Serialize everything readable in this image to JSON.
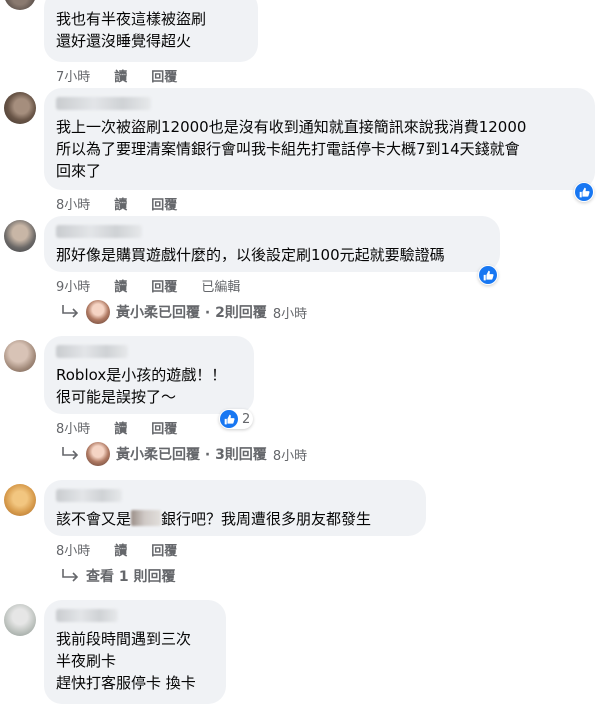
{
  "comments": [
    {
      "text_lines": [
        "我也有半夜這樣被盜刷",
        "還好還沒睡覺得超火"
      ],
      "time": "7小時",
      "reply_label": "讀",
      "respond_label": "回覆"
    },
    {
      "text_lines": [
        "我上一次被盜刷12000也是沒有收到通知就直接簡訊來說我消費12000",
        "所以為了要理清案情銀行會叫我卡組先打電話停卡大概7到14天錢就會",
        "回來了"
      ],
      "time": "8小時",
      "reply_label": "讀",
      "respond_label": "回覆"
    },
    {
      "text_lines": [
        "那好像是購買遊戲什麼的，以後設定刷100元起就要驗證碼"
      ],
      "time": "9小時",
      "reply_label": "讀",
      "respond_label": "回覆",
      "edited_label": "已編輯",
      "reply_thread": {
        "author": "黃小柔",
        "summary": "已回覆 · 2則回覆",
        "time": "8小時"
      }
    },
    {
      "text_lines": [
        "Roblox是小孩的遊戲！！",
        "很可能是誤按了～"
      ],
      "time": "8小時",
      "reply_label": "讀",
      "respond_label": "回覆",
      "reaction_count": "2",
      "reply_thread": {
        "author": "黃小柔",
        "summary": "已回覆 · 3則回覆",
        "time": "8小時"
      }
    },
    {
      "text_before": "該不會又是",
      "text_after": "銀行吧？我周遭很多朋友都發生",
      "time": "8小時",
      "reply_label": "讀",
      "respond_label": "回覆",
      "view_replies": "查看 1 則回覆"
    },
    {
      "text_lines": [
        "我前段時間遇到三次",
        "半夜刷卡",
        "趕快打客服停卡 換卡"
      ]
    }
  ],
  "colors": {
    "bubble": "#f0f2f5",
    "meta": "#65676b",
    "like": "#1877f2"
  },
  "icons": [
    "like-reaction-icon",
    "reply-arrow-icon"
  ]
}
